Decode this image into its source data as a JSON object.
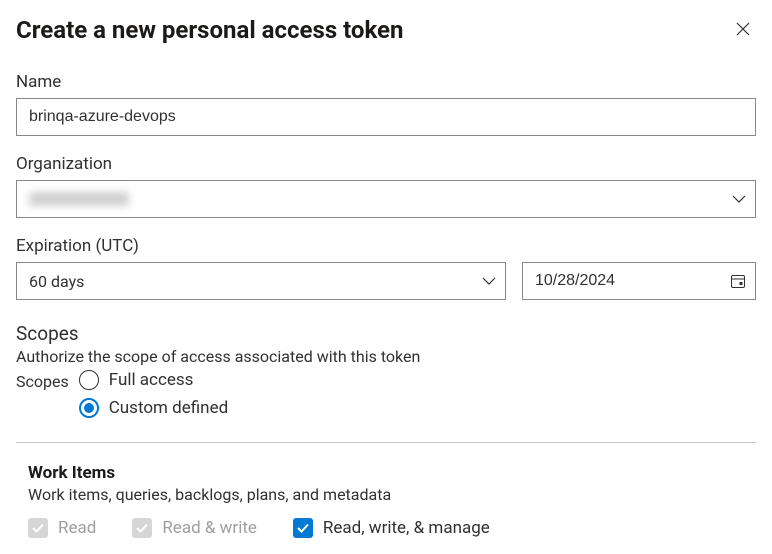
{
  "header": {
    "title": "Create a new personal access token"
  },
  "fields": {
    "name": {
      "label": "Name",
      "value": "brinqa-azure-devops"
    },
    "organization": {
      "label": "Organization",
      "value": ""
    },
    "expiration": {
      "label": "Expiration (UTC)",
      "duration": "60 days",
      "date": "10/28/2024"
    }
  },
  "scopes": {
    "title": "Scopes",
    "description": "Authorize the scope of access associated with this token",
    "label": "Scopes",
    "options": {
      "full": "Full access",
      "custom": "Custom defined"
    },
    "selected": "custom"
  },
  "scope_categories": [
    {
      "title": "Work Items",
      "description": "Work items, queries, backlogs, plans, and metadata",
      "permissions": [
        {
          "label": "Read",
          "checked": false,
          "disabled": true
        },
        {
          "label": "Read & write",
          "checked": false,
          "disabled": true
        },
        {
          "label": "Read, write, & manage",
          "checked": true,
          "disabled": false
        }
      ]
    }
  ]
}
